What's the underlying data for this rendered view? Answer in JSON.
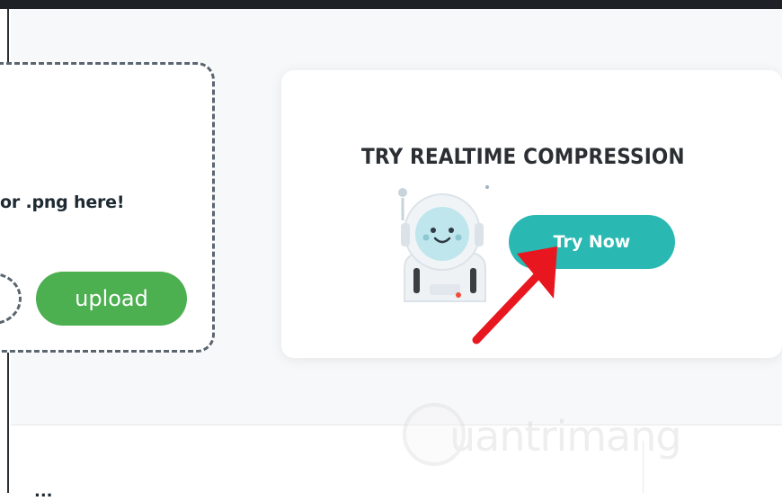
{
  "dropzone": {
    "hint_text": "or .png here!",
    "upload_label": "upload"
  },
  "realtime_card": {
    "title": "TRY REALTIME COMPRESSION",
    "button_label": "Try Now"
  },
  "lower_panel": {
    "partial_text": "..."
  },
  "watermark": {
    "text": "uantrimang"
  },
  "colors": {
    "upload_green": "#4caf50",
    "try_teal": "#29b8b2",
    "arrow_red": "#e8171f"
  }
}
